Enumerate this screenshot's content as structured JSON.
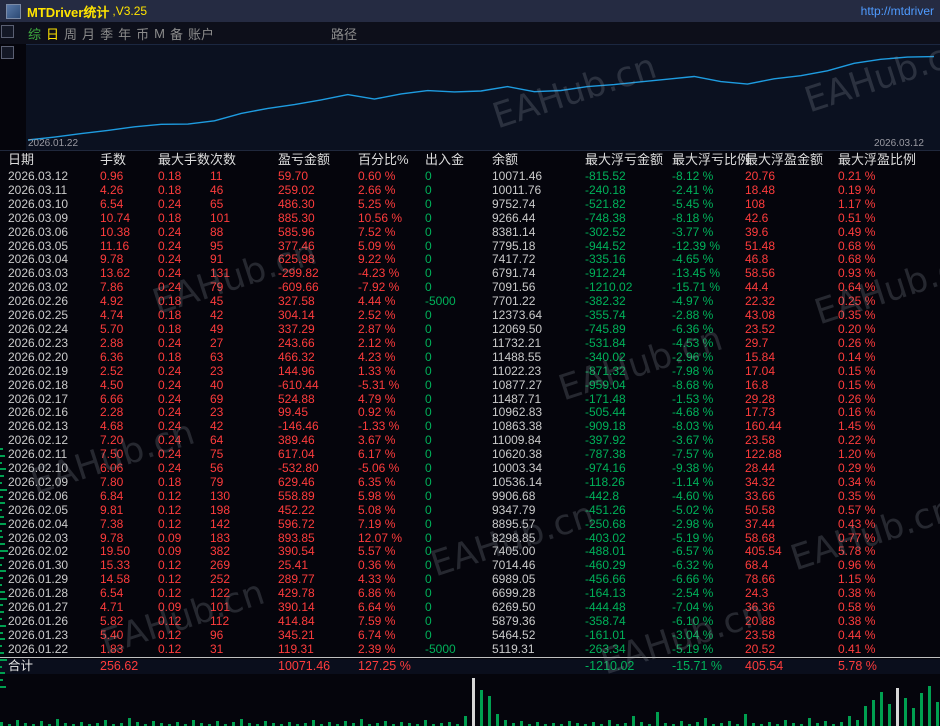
{
  "titlebar": {
    "title": "MTDriver统计",
    "version": ",V3.25",
    "url": "http://mtdriver"
  },
  "menubar": {
    "items": [
      {
        "label": "综",
        "state": "accent"
      },
      {
        "label": "日",
        "state": "selected"
      },
      {
        "label": "周",
        "state": "normal"
      },
      {
        "label": "月",
        "state": "normal"
      },
      {
        "label": "季",
        "state": "normal"
      },
      {
        "label": "年",
        "state": "normal"
      },
      {
        "label": "币",
        "state": "normal"
      },
      {
        "label": "M",
        "state": "normal"
      },
      {
        "label": "备",
        "state": "normal"
      },
      {
        "label": "账户",
        "state": "normal"
      }
    ],
    "path_label": "路径"
  },
  "chart": {
    "start_label": "2026.01.22",
    "end_label": "2026.03.12"
  },
  "chart_data": {
    "type": "line",
    "x": [
      "2026.01.22",
      "2026.01.23",
      "2026.01.26",
      "2026.01.27",
      "2026.01.28",
      "2026.01.29",
      "2026.01.30",
      "2026.02.02",
      "2026.02.03",
      "2026.02.04",
      "2026.02.05",
      "2026.02.06",
      "2026.02.09",
      "2026.02.10",
      "2026.02.11",
      "2026.02.12",
      "2026.02.13",
      "2026.02.16",
      "2026.02.17",
      "2026.02.18",
      "2026.02.19",
      "2026.02.20",
      "2026.02.23",
      "2026.02.24",
      "2026.02.25",
      "2026.02.26",
      "2026.03.02",
      "2026.03.03",
      "2026.03.04",
      "2026.03.05",
      "2026.03.06",
      "2026.03.09",
      "2026.03.10",
      "2026.03.11",
      "2026.03.12"
    ],
    "values": [
      119.31,
      464.52,
      879.36,
      1269.5,
      1699.28,
      1989.05,
      2014.46,
      2405.0,
      3298.85,
      3895.57,
      4347.79,
      4906.68,
      5536.14,
      5003.34,
      5620.38,
      6009.84,
      5863.38,
      5962.83,
      6487.71,
      5877.27,
      6022.23,
      6488.55,
      6732.21,
      7069.5,
      7373.64,
      7701.22,
      7091.56,
      6791.74,
      7417.72,
      7795.18,
      8381.14,
      9266.44,
      9752.74,
      10011.76,
      10071.46
    ],
    "ylim": [
      0,
      10500
    ],
    "line_color": "#1e9ce0",
    "legend": "cumulative profit curve"
  },
  "table": {
    "headers": [
      "日期",
      "手数",
      "最大手数次数",
      "盈亏金额",
      "百分比%",
      "出入金",
      "余额",
      "最大浮亏金额",
      "最大浮亏比例",
      "最大浮盈金额",
      "最大浮盈比例"
    ],
    "rows": [
      [
        "2026.03.12",
        "0.96",
        "0.18",
        "11",
        "59.70",
        "0.60 %",
        "0",
        "10071.46",
        "-815.52",
        "-8.12 %",
        "20.76",
        "0.21 %"
      ],
      [
        "2026.03.11",
        "4.26",
        "0.18",
        "46",
        "259.02",
        "2.66 %",
        "0",
        "10011.76",
        "-240.18",
        "-2.41 %",
        "18.48",
        "0.19 %"
      ],
      [
        "2026.03.10",
        "6.54",
        "0.24",
        "65",
        "486.30",
        "5.25 %",
        "0",
        "9752.74",
        "-521.82",
        "-5.45 %",
        "108",
        "1.17 %"
      ],
      [
        "2026.03.09",
        "10.74",
        "0.18",
        "101",
        "885.30",
        "10.56 %",
        "0",
        "9266.44",
        "-748.38",
        "-8.18 %",
        "42.6",
        "0.51 %"
      ],
      [
        "2026.03.06",
        "10.38",
        "0.24",
        "88",
        "585.96",
        "7.52 %",
        "0",
        "8381.14",
        "-302.52",
        "-3.77 %",
        "39.6",
        "0.49 %"
      ],
      [
        "2026.03.05",
        "11.16",
        "0.24",
        "95",
        "377.46",
        "5.09 %",
        "0",
        "7795.18",
        "-944.52",
        "-12.39 %",
        "51.48",
        "0.68 %"
      ],
      [
        "2026.03.04",
        "9.78",
        "0.24",
        "91",
        "625.98",
        "9.22 %",
        "0",
        "7417.72",
        "-335.16",
        "-4.65 %",
        "46.8",
        "0.68 %"
      ],
      [
        "2026.03.03",
        "13.62",
        "0.24",
        "131",
        "-299.82",
        "-4.23 %",
        "0",
        "6791.74",
        "-912.24",
        "-13.45 %",
        "58.56",
        "0.93 %"
      ],
      [
        "2026.03.02",
        "7.86",
        "0.24",
        "79",
        "-609.66",
        "-7.92 %",
        "0",
        "7091.56",
        "-1210.02",
        "-15.71 %",
        "44.4",
        "0.64 %"
      ],
      [
        "2026.02.26",
        "4.92",
        "0.18",
        "45",
        "327.58",
        "4.44 %",
        "-5000",
        "7701.22",
        "-382.32",
        "-4.97 %",
        "22.32",
        "0.25 %"
      ],
      [
        "2026.02.25",
        "4.74",
        "0.18",
        "42",
        "304.14",
        "2.52 %",
        "0",
        "12373.64",
        "-355.74",
        "-2.88 %",
        "43.08",
        "0.35 %"
      ],
      [
        "2026.02.24",
        "5.70",
        "0.18",
        "49",
        "337.29",
        "2.87 %",
        "0",
        "12069.50",
        "-745.89",
        "-6.36 %",
        "23.52",
        "0.20 %"
      ],
      [
        "2026.02.23",
        "2.88",
        "0.24",
        "27",
        "243.66",
        "2.12 %",
        "0",
        "11732.21",
        "-531.84",
        "-4.53 %",
        "29.7",
        "0.26 %"
      ],
      [
        "2026.02.20",
        "6.36",
        "0.18",
        "63",
        "466.32",
        "4.23 %",
        "0",
        "11488.55",
        "-340.02",
        "-2.96 %",
        "15.84",
        "0.14 %"
      ],
      [
        "2026.02.19",
        "2.52",
        "0.24",
        "23",
        "144.96",
        "1.33 %",
        "0",
        "11022.23",
        "-871.32",
        "-7.98 %",
        "17.04",
        "0.15 %"
      ],
      [
        "2026.02.18",
        "4.50",
        "0.24",
        "40",
        "-610.44",
        "-5.31 %",
        "0",
        "10877.27",
        "-959.04",
        "-8.68 %",
        "16.8",
        "0.15 %"
      ],
      [
        "2026.02.17",
        "6.66",
        "0.24",
        "69",
        "524.88",
        "4.79 %",
        "0",
        "11487.71",
        "-171.48",
        "-1.53 %",
        "29.28",
        "0.26 %"
      ],
      [
        "2026.02.16",
        "2.28",
        "0.24",
        "23",
        "99.45",
        "0.92 %",
        "0",
        "10962.83",
        "-505.44",
        "-4.68 %",
        "17.73",
        "0.16 %"
      ],
      [
        "2026.02.13",
        "4.68",
        "0.24",
        "42",
        "-146.46",
        "-1.33 %",
        "0",
        "10863.38",
        "-909.18",
        "-8.03 %",
        "160.44",
        "1.45 %"
      ],
      [
        "2026.02.12",
        "7.20",
        "0.24",
        "64",
        "389.46",
        "3.67 %",
        "0",
        "11009.84",
        "-397.92",
        "-3.67 %",
        "23.58",
        "0.22 %"
      ],
      [
        "2026.02.11",
        "7.50",
        "0.24",
        "75",
        "617.04",
        "6.17 %",
        "0",
        "10620.38",
        "-787.38",
        "-7.57 %",
        "122.88",
        "1.20 %"
      ],
      [
        "2026.02.10",
        "6.06",
        "0.24",
        "56",
        "-532.80",
        "-5.06 %",
        "0",
        "10003.34",
        "-974.16",
        "-9.38 %",
        "28.44",
        "0.29 %"
      ],
      [
        "2026.02.09",
        "7.80",
        "0.18",
        "79",
        "629.46",
        "6.35 %",
        "0",
        "10536.14",
        "-118.26",
        "-1.14 %",
        "34.32",
        "0.34 %"
      ],
      [
        "2026.02.06",
        "6.84",
        "0.12",
        "130",
        "558.89",
        "5.98 %",
        "0",
        "9906.68",
        "-442.8",
        "-4.60 %",
        "33.66",
        "0.35 %"
      ],
      [
        "2026.02.05",
        "9.81",
        "0.12",
        "198",
        "452.22",
        "5.08 %",
        "0",
        "9347.79",
        "-451.26",
        "-5.02 %",
        "50.58",
        "0.57 %"
      ],
      [
        "2026.02.04",
        "7.38",
        "0.12",
        "142",
        "596.72",
        "7.19 %",
        "0",
        "8895.57",
        "-250.68",
        "-2.98 %",
        "37.44",
        "0.43 %"
      ],
      [
        "2026.02.03",
        "9.78",
        "0.09",
        "183",
        "893.85",
        "12.07 %",
        "0",
        "8298.85",
        "-403.02",
        "-5.19 %",
        "58.68",
        "0.77 %"
      ],
      [
        "2026.02.02",
        "19.50",
        "0.09",
        "382",
        "390.54",
        "5.57 %",
        "0",
        "7405.00",
        "-488.01",
        "-6.57 %",
        "405.54",
        "5.78 %"
      ],
      [
        "2026.01.30",
        "15.33",
        "0.12",
        "269",
        "25.41",
        "0.36 %",
        "0",
        "7014.46",
        "-460.29",
        "-6.32 %",
        "68.4",
        "0.96 %"
      ],
      [
        "2026.01.29",
        "14.58",
        "0.12",
        "252",
        "289.77",
        "4.33 %",
        "0",
        "6989.05",
        "-456.66",
        "-6.66 %",
        "78.66",
        "1.15 %"
      ],
      [
        "2026.01.28",
        "6.54",
        "0.12",
        "122",
        "429.78",
        "6.86 %",
        "0",
        "6699.28",
        "-164.13",
        "-2.54 %",
        "24.3",
        "0.38 %"
      ],
      [
        "2026.01.27",
        "4.71",
        "0.09",
        "101",
        "390.14",
        "6.64 %",
        "0",
        "6269.50",
        "-444.48",
        "-7.04 %",
        "36.36",
        "0.58 %"
      ],
      [
        "2026.01.26",
        "5.82",
        "0.12",
        "112",
        "414.84",
        "7.59 %",
        "0",
        "5879.36",
        "-358.74",
        "-6.10 %",
        "20.88",
        "0.38 %"
      ],
      [
        "2026.01.23",
        "5.40",
        "0.12",
        "96",
        "345.21",
        "6.74 %",
        "0",
        "5464.52",
        "-161.01",
        "-3.04 %",
        "23.58",
        "0.44 %"
      ],
      [
        "2026.01.22",
        "1.83",
        "0.12",
        "31",
        "119.31",
        "2.39 %",
        "-5000",
        "5119.31",
        "-263.34",
        "-5.19 %",
        "20.52",
        "0.41 %"
      ]
    ],
    "total": [
      "合计",
      "256.62",
      "",
      "",
      "10071.46",
      "127.25 %",
      "",
      "",
      "-1210.02",
      "-15.71 %",
      "405.54",
      "5.78 %"
    ]
  },
  "bottom_histogram": {
    "bar_color": "#00a050",
    "heights": [
      4,
      2,
      6,
      3,
      2,
      5,
      2,
      7,
      3,
      2,
      4,
      2,
      3,
      6,
      2,
      3,
      8,
      4,
      2,
      5,
      3,
      2,
      4,
      2,
      6,
      3,
      2,
      5,
      2,
      4,
      7,
      3,
      2,
      5,
      3,
      2,
      4,
      2,
      3,
      6,
      2,
      4,
      2,
      5,
      3,
      7,
      2,
      3,
      5,
      2,
      4,
      3,
      2,
      6,
      2,
      3,
      4,
      2,
      10,
      48,
      36,
      30,
      12,
      6,
      3,
      5,
      2,
      4,
      2,
      3,
      2,
      5,
      3,
      2,
      4,
      2,
      6,
      2,
      3,
      10,
      4,
      2,
      14,
      3,
      2,
      5,
      2,
      4,
      8,
      2,
      3,
      5,
      2,
      12,
      3,
      2,
      4,
      2,
      6,
      3,
      2,
      8,
      3,
      5,
      2,
      4,
      10,
      6,
      20,
      26,
      34,
      22,
      38,
      28,
      18,
      33,
      40,
      24
    ],
    "white_indices": [
      59,
      112
    ]
  },
  "left_ticks": {
    "widths": [
      3,
      5,
      2,
      6,
      4,
      2,
      7,
      3,
      5,
      2,
      4,
      6,
      2,
      3,
      5,
      8,
      4,
      2,
      6,
      3,
      2,
      5,
      7,
      3,
      4,
      2,
      6,
      3,
      5,
      2,
      4,
      7,
      2,
      5,
      3,
      6
    ]
  },
  "watermark": {
    "text": "EAHub.cn"
  },
  "colors": {
    "positive_red": "#ff3c3c",
    "negative_green": "#00b25a",
    "title_yellow": "#ffe400",
    "link_blue": "#4f9bff",
    "equity_line": "#1e9ce0"
  }
}
